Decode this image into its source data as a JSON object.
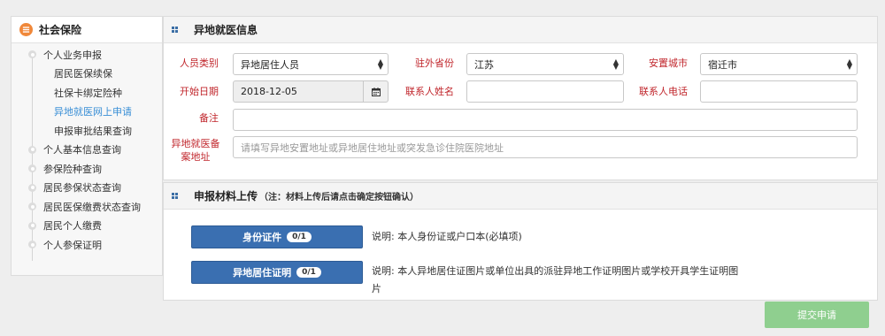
{
  "sidebar": {
    "title": "社会保险",
    "items": [
      {
        "label": "个人业务申报"
      },
      {
        "label": "居民医保续保"
      },
      {
        "label": "社保卡绑定险种"
      },
      {
        "label": "异地就医网上申请"
      },
      {
        "label": "申报审批结果查询"
      },
      {
        "label": "个人基本信息查询"
      },
      {
        "label": "参保险种查询"
      },
      {
        "label": "居民参保状态查询"
      },
      {
        "label": "居民医保缴费状态查询"
      },
      {
        "label": "居民个人缴费"
      },
      {
        "label": "个人参保证明"
      }
    ]
  },
  "info_panel": {
    "title": "异地就医信息",
    "person_type_label": "人员类别",
    "person_type_value": "异地居住人员",
    "province_label": "驻外省份",
    "province_value": "江苏",
    "city_label": "安置城市",
    "city_value": "宿迁市",
    "start_date_label": "开始日期",
    "start_date_value": "2018-12-05",
    "contact_name_label": "联系人姓名",
    "contact_name_value": "",
    "contact_phone_label": "联系人电话",
    "contact_phone_value": "",
    "remark_label": "备注",
    "remark_value": "",
    "address_label_1": "异地就医备",
    "address_label_2": "案地址",
    "address_placeholder": "请填写异地安置地址或异地居住地址或突发急诊住院医院地址"
  },
  "upload_panel": {
    "title": "申报材料上传",
    "note": "（注：材料上传后请点击确定按钮确认）",
    "id_button_label": "身份证件",
    "id_count": "0/1",
    "id_desc": "说明: 本人身份证或户口本(必填项)",
    "residence_button_label": "异地居住证明",
    "residence_count": "0/1",
    "residence_desc_1": "说明: 本人异地居住证图片或单位出具的派驻异地工作证明图片或学校开具学生证明图",
    "residence_desc_2": "片"
  },
  "submit_label": "提交申请",
  "colors": {
    "accent": "#3a6fb1",
    "required": "#c1272d",
    "active_link": "#3a8fd6",
    "submit": "#8fcf8f"
  }
}
